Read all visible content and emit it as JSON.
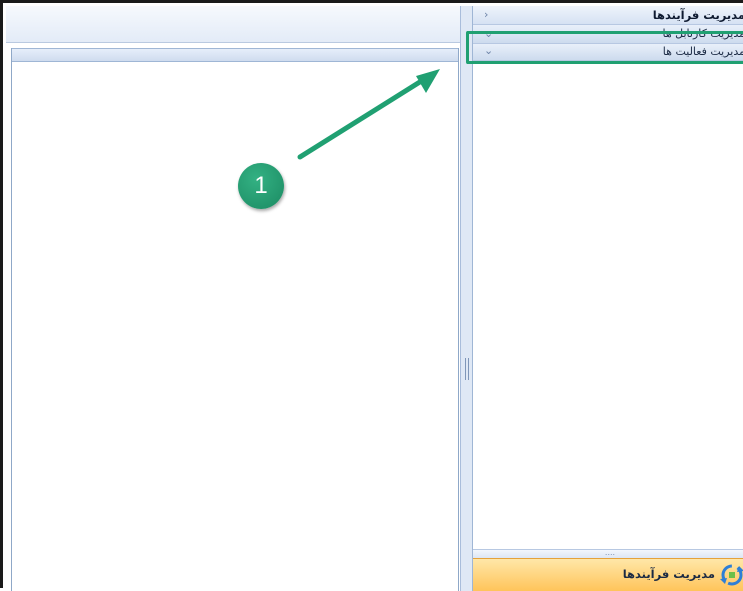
{
  "side_panel": {
    "main_row": {
      "label": "مدیریت فرآیندها",
      "chevron_icon": "chevron-left-icon"
    },
    "sub_rows": [
      {
        "label": "مدیریت کارتابل ها",
        "chevron_icon": "chevron-down-icon"
      },
      {
        "label": "مدیریت فعالیت ها",
        "chevron_icon": "chevron-down-icon"
      }
    ],
    "gripper_glyph": "....",
    "bottom_tab": {
      "label": "مدیریت فرآیندها",
      "icon": "process-management-icon"
    }
  },
  "annotation": {
    "step_number": "1",
    "color": "#20a072"
  },
  "colors": {
    "panel_header": "#d6e2f3",
    "bottom_tab": "#ffc45a",
    "highlight": "#20a072"
  }
}
